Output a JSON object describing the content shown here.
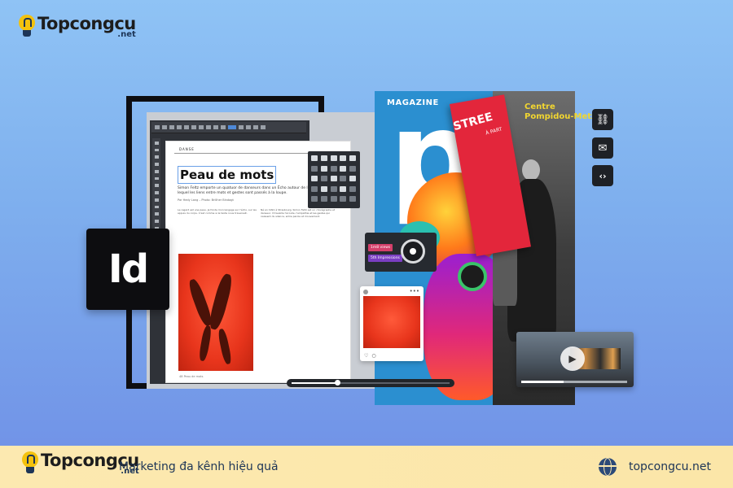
{
  "brand": {
    "logo_main": "Topcongcu",
    "logo_sub": ".net"
  },
  "document": {
    "section_label": "DANSE",
    "headline": "Peau de mots",
    "lead": "Simon Feltz emporte un quatuor de danseurs dans un Écho autour de l'empathie, dans lequel les liens entre mots et gestes sont passés à la loupe.",
    "byline": "Par Hedy Lang – Photo: Brillher Bindagt",
    "body_col1": "Le regard est une peau. Je fonde mon langage sur l'écho, sur les appuis du corps. C'est comme si le texte nous traversait.",
    "body_col2": "Né en 1991 à Strasbourg, Simon Feltz est un chorégraphe et danseur. Il travaille l'écoute, l'empathie et les gestes qui naissent du silence, entre parole et mouvement.",
    "footer": "48 Peau de mots"
  },
  "app_icon": {
    "label": "Id"
  },
  "magazine": {
    "label": "MAGAZINE",
    "big_letters": "pol",
    "panel_title": "STREE",
    "panel_sub": "À PART",
    "centre_text": "Centre\nPompidou-Metz"
  },
  "widgets": {
    "tag1": "1m8 views",
    "tag2": "5th Impressions",
    "scrubber_progress": 0.29,
    "video_progress": 0.4
  },
  "share": {
    "link_icon": "link-icon",
    "mail_icon": "mail-icon",
    "embed_icon": "code-icon"
  },
  "footer": {
    "tagline": "Marketing đa kênh hiệu quả",
    "site": "topcongcu.net"
  },
  "colors": {
    "accent_red": "#e3263b",
    "magazine_blue": "#2b8fd0",
    "bar_bg": "#fce9b0",
    "text_dark": "#1d3557"
  }
}
